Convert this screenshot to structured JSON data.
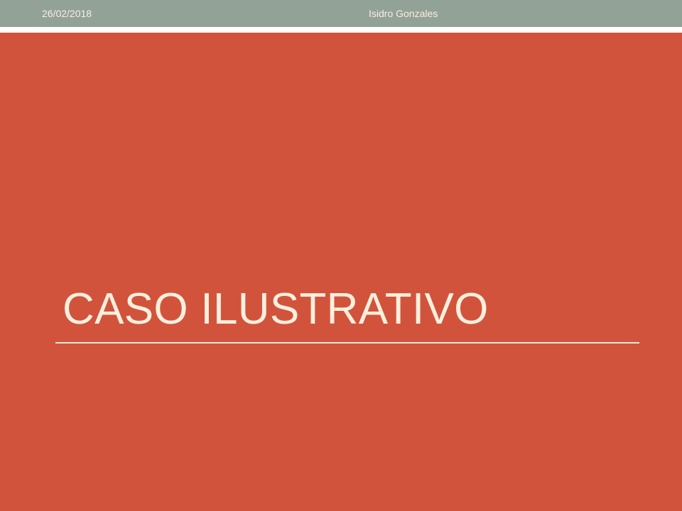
{
  "slide": {
    "date": "26/02/2018",
    "author": "Isidro Gonzales",
    "title": "CASO ILUSTRATIVO"
  },
  "colors": {
    "background": "#d2533c",
    "top_band": "#92a297",
    "title_text": "#fbf0dd",
    "rule": "#f7e6d8"
  }
}
